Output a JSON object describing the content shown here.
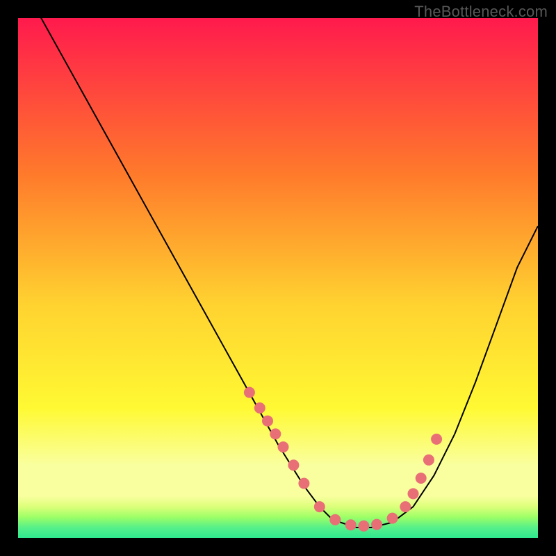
{
  "watermark": "TheBottleneck.com",
  "colors": {
    "background": "#000000",
    "watermark_text": "#575757",
    "gradient_top": "#ff1a4d",
    "gradient_mid1": "#ff7a2b",
    "gradient_mid2": "#ffd230",
    "gradient_mid3": "#fff933",
    "gradient_band_light": "#f9ff9e",
    "gradient_band_green1": "#9dff66",
    "gradient_band_green2": "#2fe88f",
    "curve": "#000000",
    "markers": "#e96f77"
  },
  "chart_data": {
    "type": "line",
    "title": "",
    "xlabel": "",
    "ylabel": "",
    "xlim": [
      0,
      100
    ],
    "ylim": [
      0,
      100
    ],
    "series": [
      {
        "name": "bottleneck-curve",
        "x": [
          0,
          5,
          10,
          15,
          20,
          25,
          30,
          35,
          40,
          45,
          50,
          55,
          58,
          60,
          62,
          65,
          68,
          72,
          76,
          80,
          84,
          88,
          92,
          96,
          100
        ],
        "y": [
          108,
          99,
          90,
          81,
          72,
          63,
          54,
          45,
          36,
          27,
          18,
          10,
          6,
          4,
          3,
          2,
          2,
          3,
          6,
          12,
          20,
          30,
          41,
          52,
          60
        ]
      }
    ],
    "markers": {
      "name": "highlight-dots",
      "x": [
        44.5,
        46.5,
        48,
        49.5,
        51,
        53,
        55,
        58,
        61,
        64,
        66.5,
        69,
        72,
        74.5,
        76,
        77.5,
        79,
        80.5
      ],
      "y": [
        28,
        25,
        22.5,
        20,
        17.5,
        14,
        10.5,
        6,
        3.5,
        2.5,
        2.3,
        2.6,
        3.8,
        6,
        8.5,
        11.5,
        15,
        19
      ]
    }
  }
}
